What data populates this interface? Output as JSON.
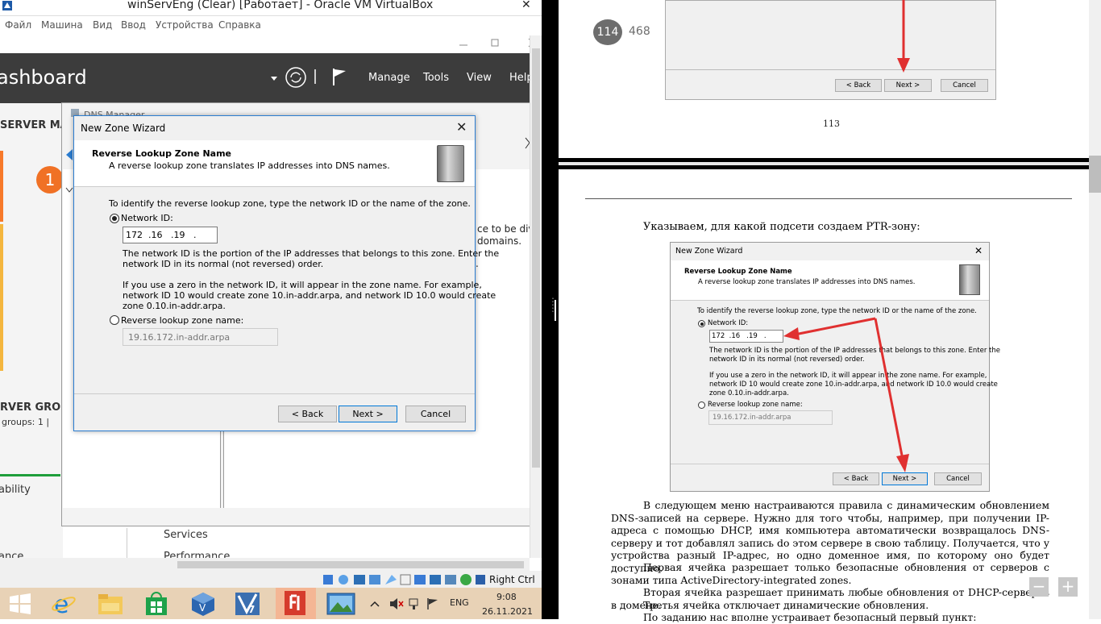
{
  "vbox": {
    "title": "winServEng (Clear) [Работает] - Oracle VM VirtualBox",
    "close": "✕",
    "menu": [
      "Файл",
      "Машина",
      "Вид",
      "Ввод",
      "Устройства",
      "Справка"
    ],
    "status_right": "Right Ctrl"
  },
  "server_manager": {
    "title": "ashboard",
    "nav": [
      "Manage",
      "Tools",
      "View",
      "Help"
    ],
    "side_title": "SERVER MA",
    "badge": "1",
    "groups_title": "RVER GROU",
    "groups_count": "groups: 1  |",
    "ability": "ability",
    "services": "Services",
    "performance": "Performance",
    "ance": "ance"
  },
  "dns_manager": {
    "title": "DNS Manager",
    "text1": "ce to be divi",
    "text2": "domains.",
    "text3": "."
  },
  "wizard": {
    "title": "New Zone Wizard",
    "close": "✕",
    "heading": "Reverse Lookup Zone Name",
    "subheading": "A reverse lookup zone translates IP addresses into DNS names.",
    "instruction": "To identify the reverse lookup zone, type the network ID or the name of the zone.",
    "network_id_label": "Network ID:",
    "network_id_value": "172  .16   .19   .",
    "network_id_help1": "The network ID is the portion of the IP addresses that belongs to this zone. Enter the",
    "network_id_help2": "network ID in its normal (not reversed) order.",
    "zero_help1": "If you use a zero in the network ID, it will appear in the zone name. For example,",
    "zero_help2": "network ID 10 would create zone 10.in-addr.arpa, and network ID 10.0 would create",
    "zero_help3": "zone 0.10.in-addr.arpa.",
    "reverse_label": "Reverse lookup zone name:",
    "reverse_value": "19.16.172.in-addr.arpa",
    "back": "< Back",
    "next": "Next >",
    "cancel": "Cancel"
  },
  "taskbar": {
    "lang": "ENG",
    "time": "9:08",
    "date": "26.11.2021"
  },
  "pdf": {
    "page_current": "114",
    "page_total": "468",
    "mini_top_back": "< Back",
    "mini_top_next": "Next >",
    "mini_top_cancel": "Cancel",
    "page_number_113": "113",
    "caption": "Указываем, для какой подсети создаем PTR-зону:",
    "para1": "В следующем меню настраиваются правила с динамическим обновлением DNS-записей на сервере. Нужно для того чтобы, например, при получении IP-адреса с помощью DHCP, имя компьютера автоматически возвращалось DNS-серверу и тот добавлял запись do этом сервере в свою таблицу. Получается, что у устройства разный IP-адрес, но одно доменное имя, по которому оно будет доступно.",
    "para2": "Первая ячейка разрешает только безопасные обновления от серверов с зонами типа ActiveDirectory-integrated zones.",
    "para3": "Вторая ячейка разрешает принимать любые обновления от DHCP-серверов в домене.",
    "para4": "Третья ячейка отключает динамические обновления.",
    "para5": "По заданию нас вполне устраивает безопасный первый пункт:",
    "zoom_out": "−",
    "zoom_in": "+"
  },
  "colors": {
    "accent_blue": "#0078d7",
    "orange": "#f07125",
    "arrow_red": "#e03030",
    "sm_header": "#3c3c3c"
  }
}
